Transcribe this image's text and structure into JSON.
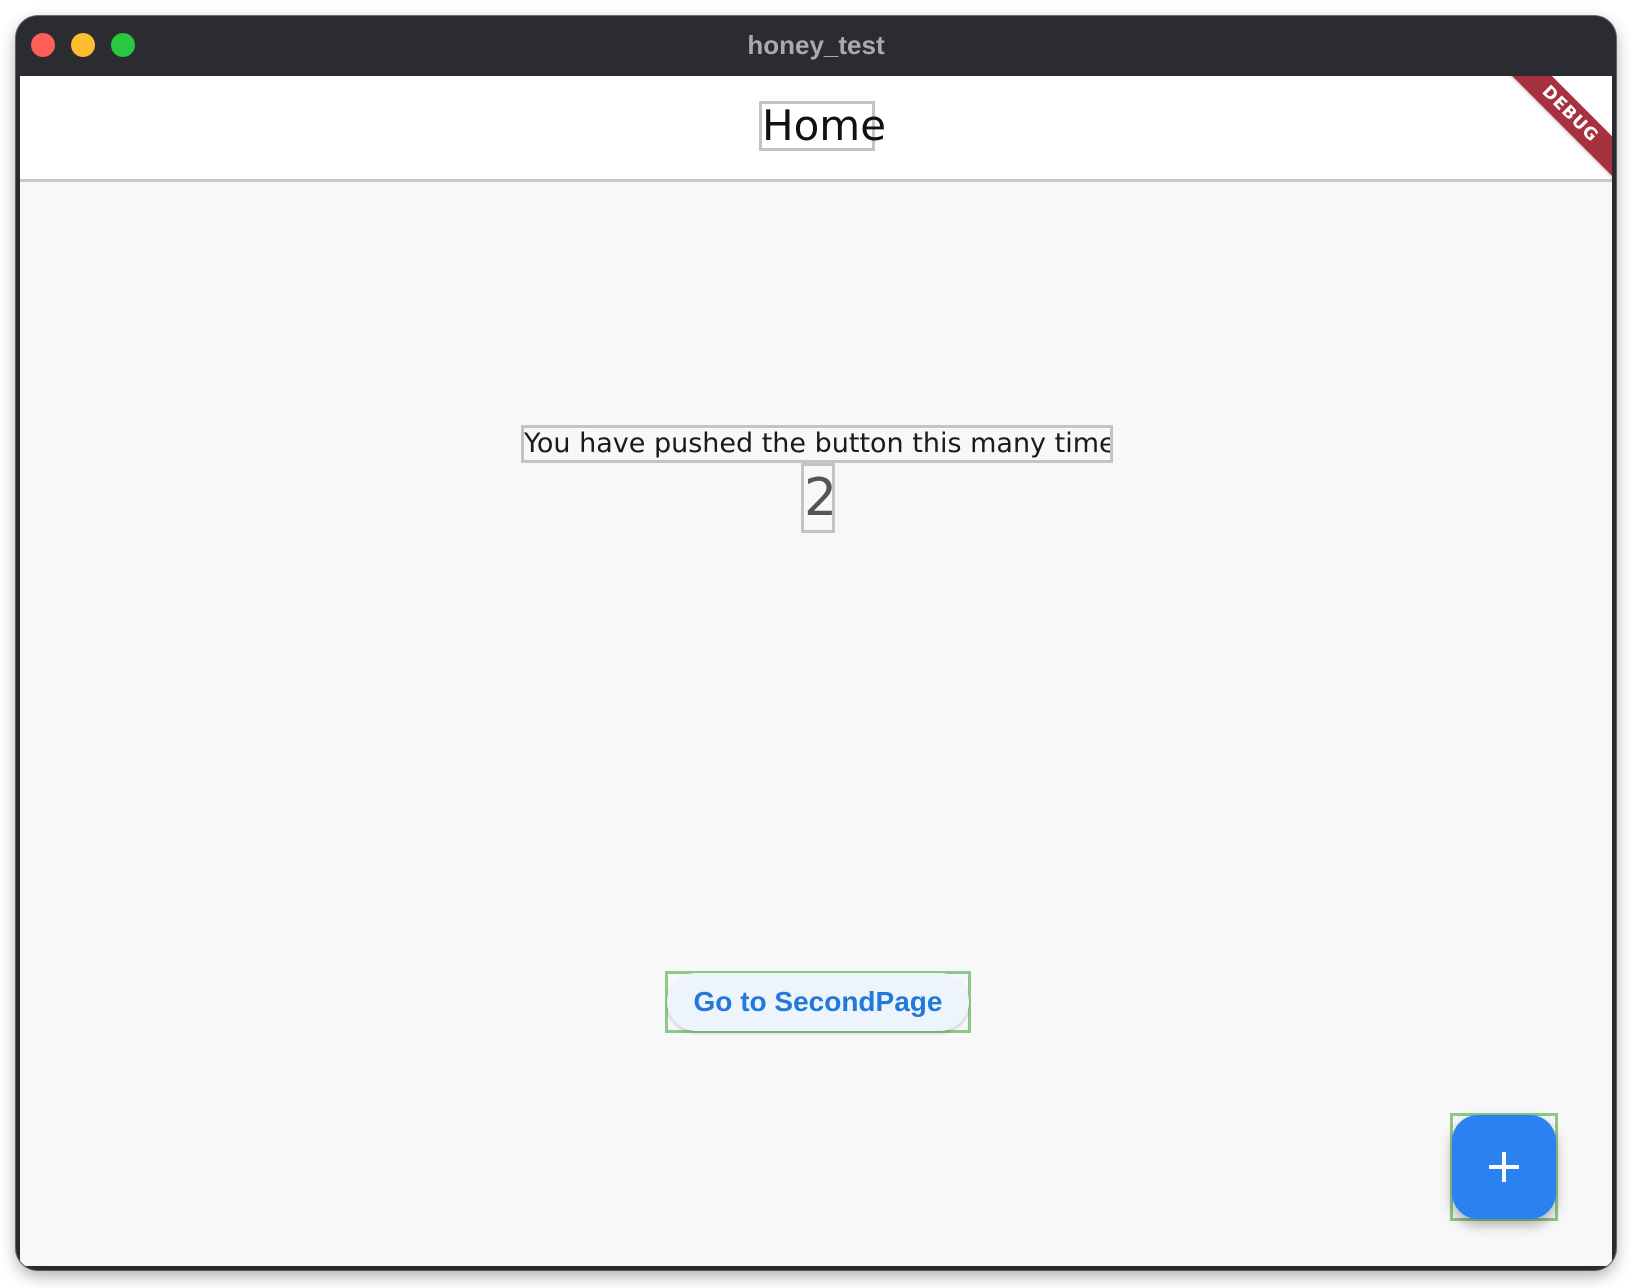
{
  "window": {
    "title": "honey_test"
  },
  "appbar": {
    "title": "Home",
    "debug_banner": "DEBUG"
  },
  "counter": {
    "label": "You have pushed the button this many times:",
    "value": "2"
  },
  "nav_button": {
    "label": "Go to SecondPage"
  },
  "fab": {
    "icon": "plus-icon"
  },
  "colors": {
    "accent": "#2a82f0",
    "button_text": "#2279d9",
    "debug_banner": "#a8313f",
    "highlight_outline": "#8dc98b",
    "widget_outline": "#c4c4c4"
  }
}
